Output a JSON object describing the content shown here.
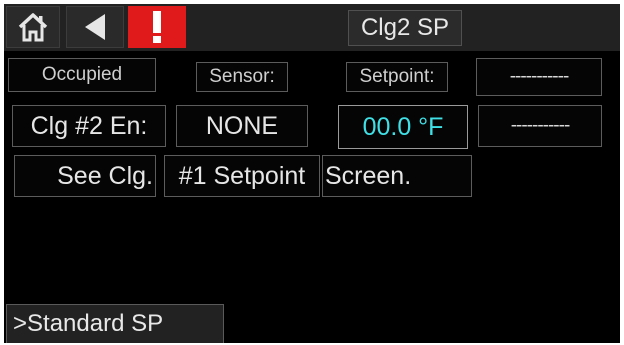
{
  "title": "Clg2 SP",
  "icons": {
    "home": "home-icon",
    "back": "back-arrow-icon",
    "alarm": "alarm-exclamation-icon"
  },
  "colors": {
    "alarm": "#e0191a",
    "setpoint_value": "#3fe0e6",
    "background": "#000000"
  },
  "labels": {
    "occupied": "Occupied",
    "sensor": "Sensor:",
    "setpoint": "Setpoint:"
  },
  "values": {
    "top_dash": "-----------",
    "clg2_en": "Clg #2 En:",
    "sensor_value": "NONE",
    "setpoint_value": "00.0 °F",
    "second_dash": "-----------"
  },
  "message": {
    "part1": "See Clg.",
    "part2": "#1 Setpoint",
    "part3": "Screen."
  },
  "bottom_tab": ">Standard SP"
}
